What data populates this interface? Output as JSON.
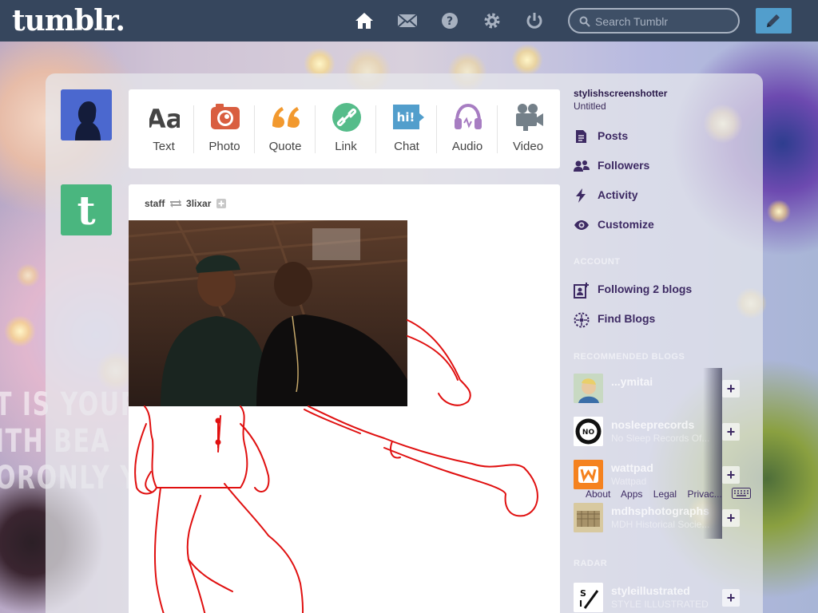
{
  "header": {
    "logo": "tumblr.",
    "search_placeholder": "Search Tumblr",
    "nav_icons": [
      "home-icon",
      "mail-icon",
      "help-icon",
      "gear-icon",
      "power-icon"
    ],
    "compose_icon": "pencil-icon"
  },
  "background": {
    "text_lines": [
      "T IS YOURS",
      "ITH BEA",
      "ORONLY Y"
    ]
  },
  "post_types": [
    {
      "label": "Text",
      "icon": "text-icon",
      "color": "#444444"
    },
    {
      "label": "Photo",
      "icon": "camera-icon",
      "color": "#d95e40"
    },
    {
      "label": "Quote",
      "icon": "quote-icon",
      "color": "#f2992e"
    },
    {
      "label": "Link",
      "icon": "link-icon",
      "color": "#56bc8a"
    },
    {
      "label": "Chat",
      "icon": "chat-icon",
      "color": "#529ecc"
    },
    {
      "label": "Audio",
      "icon": "headphones-icon",
      "color": "#a77dc2"
    },
    {
      "label": "Video",
      "icon": "video-camera-icon",
      "color": "#748089"
    }
  ],
  "post": {
    "author": "staff",
    "reblogged_from": "3lixar"
  },
  "sidebar": {
    "blog_name": "stylishscreenshotter",
    "blog_title": "Untitled",
    "links": [
      {
        "label": "Posts",
        "icon": "posts-icon"
      },
      {
        "label": "Followers",
        "icon": "followers-icon"
      },
      {
        "label": "Activity",
        "icon": "activity-icon"
      },
      {
        "label": "Customize",
        "icon": "eye-icon"
      }
    ],
    "account_header": "ACCOUNT",
    "account_links": [
      {
        "label": "Following 2 blogs",
        "icon": "following-icon"
      },
      {
        "label": "Find Blogs",
        "icon": "compass-icon"
      }
    ],
    "recommended_header": "RECOMMENDED BLOGS",
    "recommended": [
      {
        "name": "...ymitai",
        "sub": ""
      },
      {
        "name": "nosleeprecords",
        "sub": "No Sleep Records Of..."
      },
      {
        "name": "wattpad",
        "sub": "Wattpad"
      },
      {
        "name": "mdhsphotographs",
        "sub": "MDH Historical Socie..."
      }
    ],
    "radar_header": "RADAR",
    "radar": [
      {
        "name": "styleillustrated",
        "sub": "STYLE ILLUSTRATED"
      }
    ],
    "footer_links": [
      "About",
      "Apps",
      "Legal",
      "Privac..."
    ]
  }
}
